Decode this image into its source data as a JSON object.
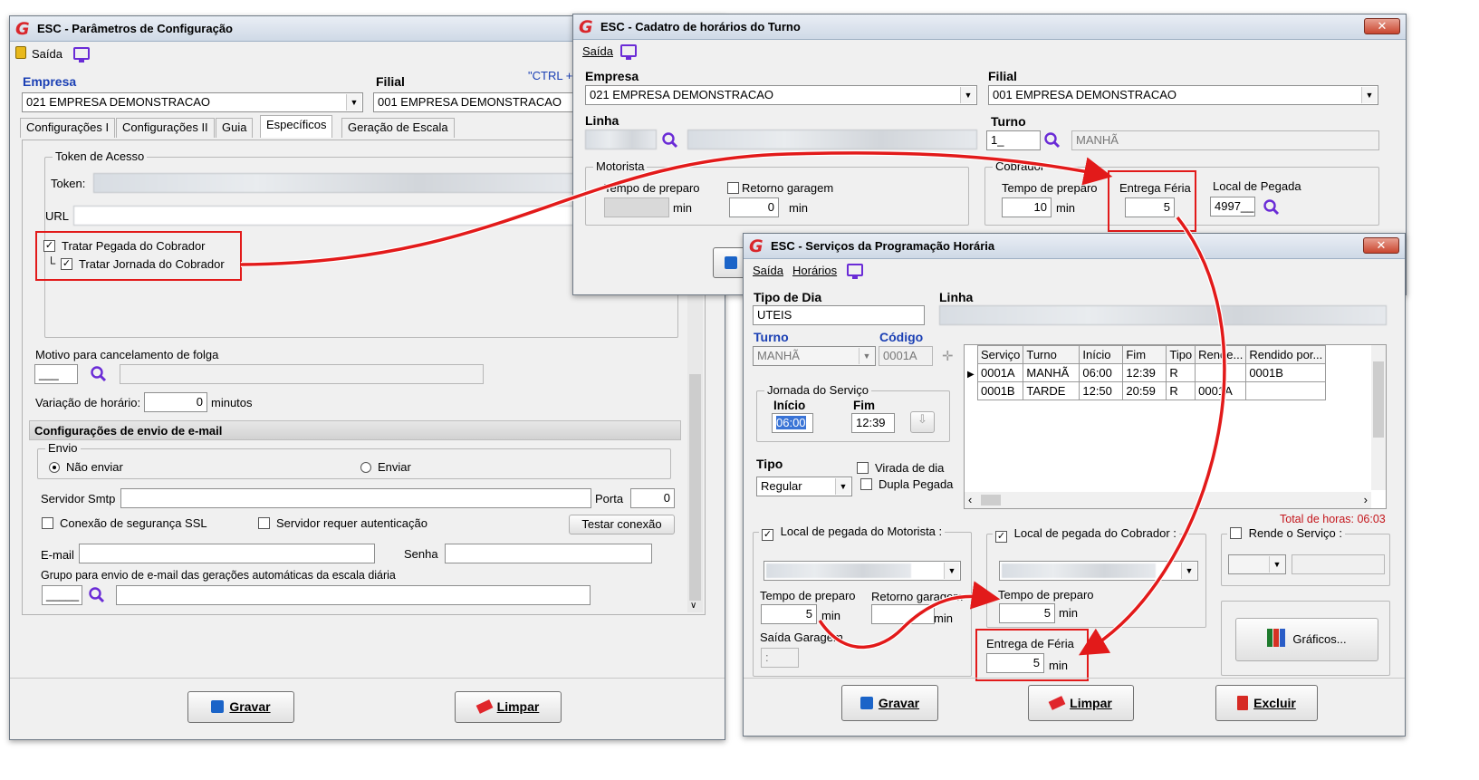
{
  "win1": {
    "title": "ESC - Parâmetros de Configuração",
    "menu_saida": "Saída",
    "ctrl_hint": "\"CTRL +",
    "empresa_label": "Empresa",
    "empresa_value": "021 EMPRESA DEMONSTRACAO",
    "filial_label": "Filial",
    "filial_value": "001 EMPRESA DEMONSTRACAO",
    "tabs": [
      "Configurações I",
      "Configurações II",
      "Guia",
      "Específicos",
      "Geração de Escala"
    ],
    "token_group": "Token de Acesso",
    "token_label": "Token:",
    "url_label": "URL",
    "chk_pegada": "Tratar  Pegada do Cobrador",
    "chk_jornada": "Tratar  Jornada do Cobrador",
    "motivo_label": "Motivo para cancelamento de folga",
    "motivo_code": "___",
    "variacao_label": "Variação de horário:",
    "variacao_value": "0",
    "variacao_unit": "minutos",
    "email_section": "Configurações de envio de e-mail",
    "envio_group": "Envio",
    "nao_enviar": "Não enviar",
    "enviar": "Enviar",
    "servidor_label": "Servidor Smtp",
    "porta_label": "Porta",
    "porta_value": "0",
    "ssl_label": "Conexão de segurança SSL",
    "auth_label": "Servidor requer autenticação",
    "testar_btn": "Testar conexão",
    "email_label": "E-mail",
    "senha_label": "Senha",
    "grupo_label": "Grupo para envio de e-mail das gerações automáticas da escala diária",
    "grupo_code": "_____",
    "gravar_btn": "Gravar",
    "limpar_btn": "Limpar"
  },
  "win2": {
    "title": "ESC - Cadatro de horários do Turno",
    "menu_saida": "Saída",
    "empresa_label": "Empresa",
    "empresa_value": "021 EMPRESA DEMONSTRACAO",
    "filial_label": "Filial",
    "filial_value": "001 EMPRESA DEMONSTRACAO",
    "linha_label": "Linha",
    "turno_label": "Turno",
    "turno_code": "1_",
    "turno_value": "MANHÃ",
    "motorista_group": "Motorista",
    "tempo_preparo_label": "Tempo de preparo",
    "retorno_label": "Retorno garagem",
    "retorno_value": "0",
    "min1": "min",
    "min2": "min",
    "cobrador_group": "Cobrador",
    "cob_tempo_label": "Tempo de preparo",
    "cob_tempo_value": "10",
    "cob_min": "min",
    "entrega_label": "Entrega Féria",
    "entrega_value": "5",
    "local_label": "Local de Pegada",
    "local_value": "4997__"
  },
  "win3": {
    "title": "ESC - Serviços da Programação Horária",
    "menu_saida": "Saída",
    "menu_horarios": "Horários",
    "tipo_dia_label": "Tipo de Dia",
    "tipo_dia_value": "UTEIS",
    "linha_label": "Linha",
    "turno_label": "Turno",
    "turno_value": "MANHÃ",
    "codigo_label": "Código",
    "codigo_value": "0001A",
    "jornada_group": "Jornada do Serviço",
    "inicio_label": "Início",
    "inicio_value": "06:00",
    "fim_label": "Fim",
    "fim_value": "12:39",
    "tipo_label": "Tipo",
    "tipo_value": "Regular",
    "virada_label": "Virada de dia",
    "dupla_label": "Dupla Pegada",
    "grid_headers": [
      "Serviço",
      "Turno",
      "Início",
      "Fim",
      "Tipo",
      "Rende...",
      "Rendido por..."
    ],
    "grid_rows": [
      [
        "0001A",
        "MANHÃ",
        "06:00",
        "12:39",
        "R",
        "",
        "0001B"
      ],
      [
        "0001B",
        "TARDE",
        "12:50",
        "20:59",
        "R",
        "0001A",
        ""
      ]
    ],
    "total_horas": "Total de horas: 06:03",
    "local_motorista": "Local de pegada do Motorista :",
    "local_cobrador": "Local de pegada do Cobrador :",
    "rende_servico": "Rende o Serviço :",
    "mot_tempo_label": "Tempo de preparo",
    "mot_tempo_value": "5",
    "mot_min": "min",
    "mot_retorno_label": "Retorno garagem",
    "mot_retorno_min": "min",
    "saida_garagem_label": "Saída Garagem",
    "saida_garagem_value": ":",
    "cob_tempo_label": "Tempo de preparo",
    "cob_tempo_value": "5",
    "cob_min": "min",
    "entrega_label": "Entrega de Féria",
    "entrega_value": "5",
    "entrega_min": "min",
    "graficos_btn": "Gráficos...",
    "gravar_btn": "Gravar",
    "limpar_btn": "Limpar",
    "excluir_btn": "Excluir"
  },
  "colors": {
    "highlight_red": "#e21a1a",
    "label_blue": "#1a3fb4",
    "accent_purple": "#6a2bd6"
  }
}
